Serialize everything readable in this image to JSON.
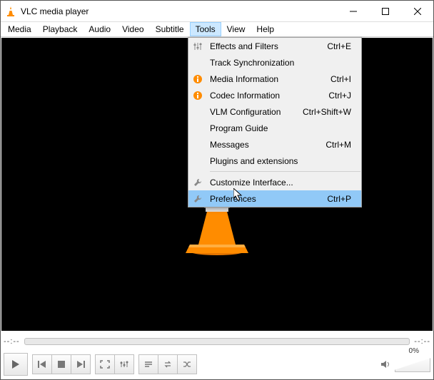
{
  "title": "VLC media player",
  "menubar": [
    "Media",
    "Playback",
    "Audio",
    "Video",
    "Subtitle",
    "Tools",
    "View",
    "Help"
  ],
  "menubar_open_index": 5,
  "tools_menu": {
    "groups": [
      [
        {
          "icon": "sliders",
          "label": "Effects and Filters",
          "shortcut": "Ctrl+E"
        },
        {
          "icon": "",
          "label": "Track Synchronization",
          "shortcut": ""
        },
        {
          "icon": "info",
          "label": "Media Information",
          "shortcut": "Ctrl+I"
        },
        {
          "icon": "info",
          "label": "Codec Information",
          "shortcut": "Ctrl+J"
        },
        {
          "icon": "",
          "label": "VLM Configuration",
          "shortcut": "Ctrl+Shift+W"
        },
        {
          "icon": "",
          "label": "Program Guide",
          "shortcut": ""
        },
        {
          "icon": "",
          "label": "Messages",
          "shortcut": "Ctrl+M"
        },
        {
          "icon": "",
          "label": "Plugins and extensions",
          "shortcut": ""
        }
      ],
      [
        {
          "icon": "wrench",
          "label": "Customize Interface...",
          "shortcut": ""
        },
        {
          "icon": "wrench",
          "label": "Preferences",
          "shortcut": "Ctrl+P",
          "selected": true
        }
      ]
    ]
  },
  "time_left": "--:--",
  "time_right": "--:--",
  "volume_pct": "0%"
}
